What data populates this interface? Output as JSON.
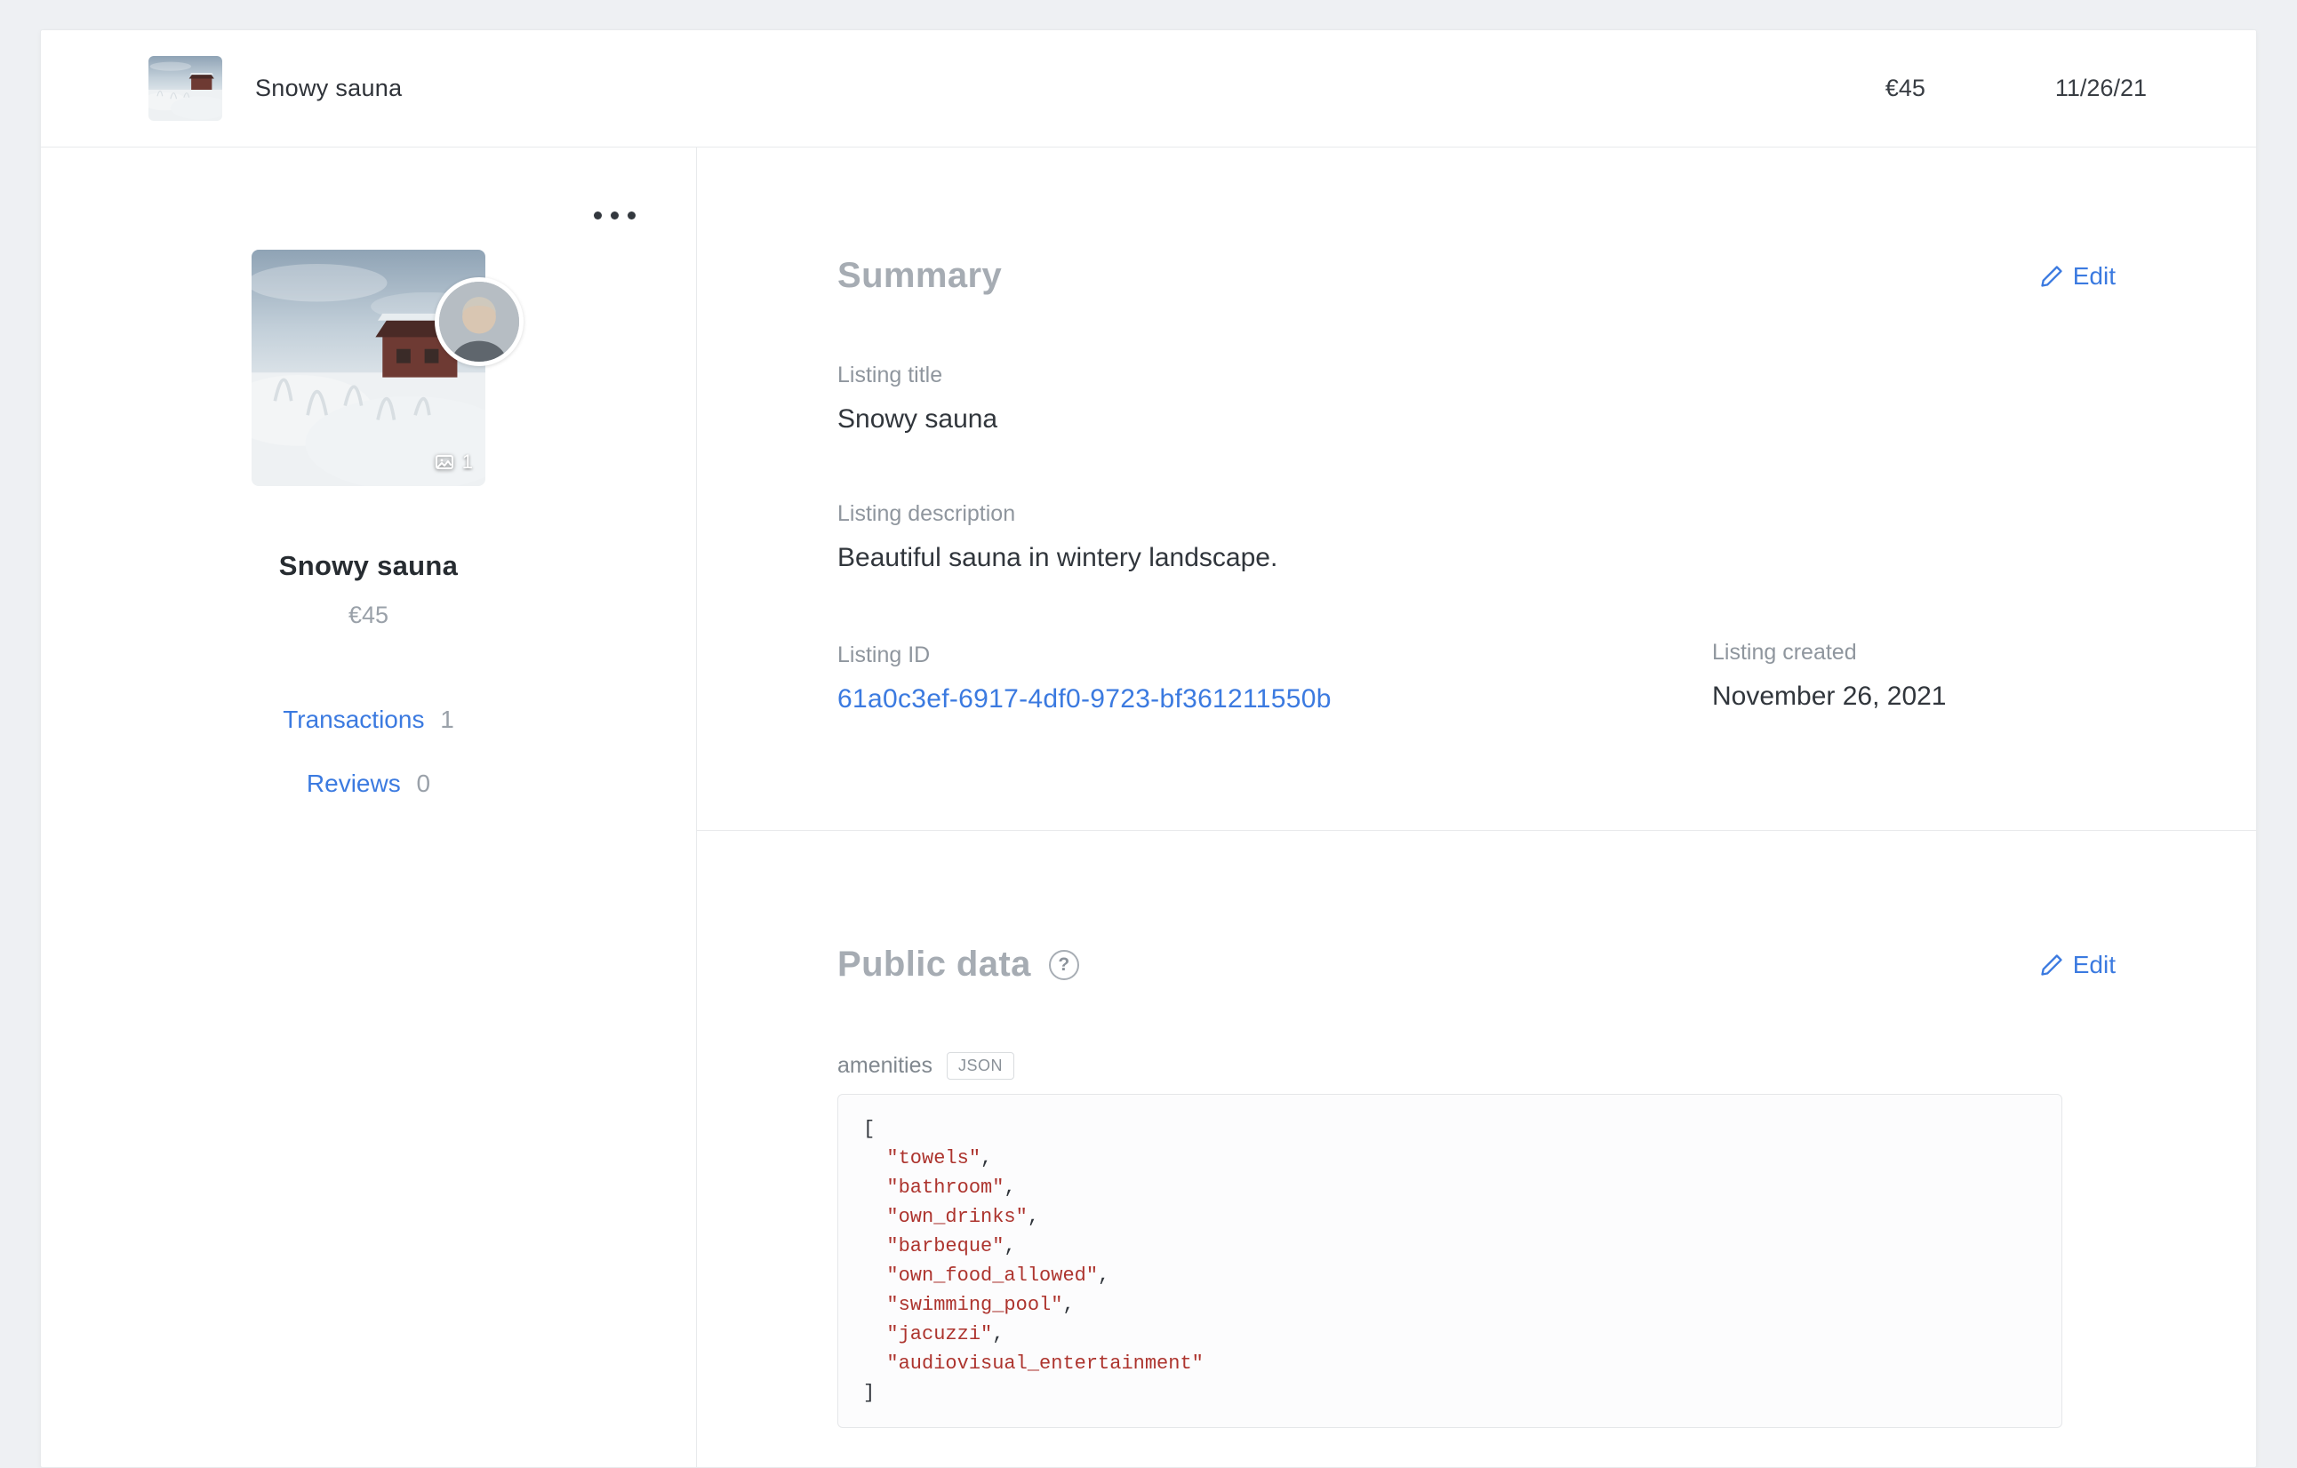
{
  "colors": {
    "accent": "#3b7ae0",
    "code_string": "#ad342e",
    "heading_gray": "#a6acb3"
  },
  "header": {
    "title": "Snowy sauna",
    "price": "€45",
    "date": "11/26/21"
  },
  "sidebar": {
    "menu_icon": "ellipsis-menu",
    "image_badge_count": "1",
    "title": "Snowy sauna",
    "price": "€45",
    "transactions_label": "Transactions",
    "transactions_count": "1",
    "reviews_label": "Reviews",
    "reviews_count": "0"
  },
  "summary": {
    "heading": "Summary",
    "edit_label": "Edit",
    "listing_title_label": "Listing title",
    "listing_title": "Snowy sauna",
    "listing_description_label": "Listing description",
    "listing_description": "Beautiful sauna in wintery landscape.",
    "listing_id_label": "Listing ID",
    "listing_id": "61a0c3ef-6917-4df0-9723-bf361211550b",
    "listing_created_label": "Listing created",
    "listing_created": "November 26, 2021"
  },
  "public_data": {
    "heading": "Public data",
    "help_icon": "?",
    "edit_label": "Edit",
    "field_label": "amenities",
    "format_badge": "JSON",
    "amenities": [
      "towels",
      "bathroom",
      "own_drinks",
      "barbeque",
      "own_food_allowed",
      "swimming_pool",
      "jacuzzi",
      "audiovisual_entertainment"
    ]
  }
}
